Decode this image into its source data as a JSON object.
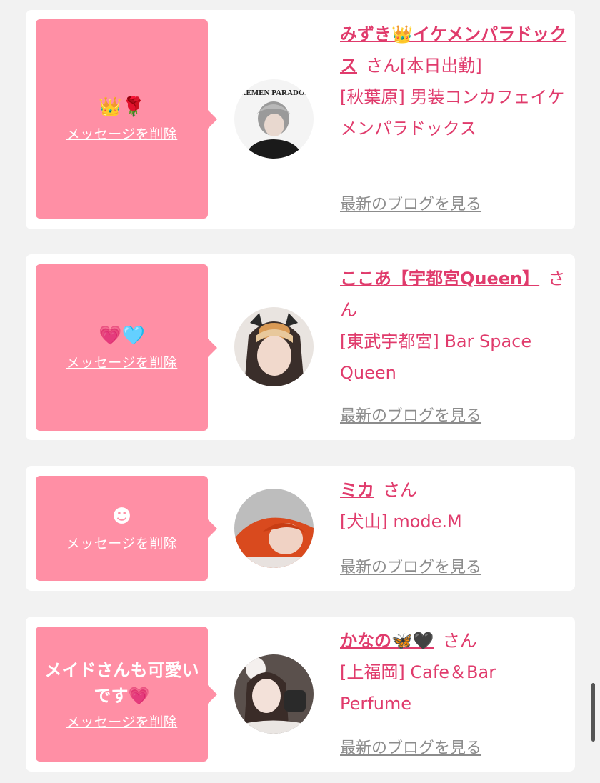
{
  "cards": [
    {
      "message": "👑🌹",
      "delete_label": "メッセージを削除",
      "name": "みずき👑イケメンパラドックス",
      "honorific": "さん[本日出勤]",
      "shop": "[秋葉原] 男装コンカフェイケメンパラドックス",
      "blog_label": "最新のブログを見る",
      "avatar_text": "IKEMEN PARADOX"
    },
    {
      "message": "💗🩵",
      "delete_label": "メッセージを削除",
      "name": "ここあ【宇都宮Queen】",
      "honorific": "さん",
      "shop": "[東武宇都宮] Bar Space Queen",
      "blog_label": "最新のブログを見る"
    },
    {
      "message": "☻",
      "delete_label": "メッセージを削除",
      "name": "ミカ",
      "honorific": "さん",
      "shop": "[犬山] mode.M",
      "blog_label": "最新のブログを見る"
    },
    {
      "message": "メイドさんも可愛いです💗",
      "delete_label": "メッセージを削除",
      "name": "かなの🦋🖤",
      "honorific": "さん",
      "shop": "[上福岡] Cafe＆Bar Perfume",
      "blog_label": "最新のブログを見る"
    }
  ],
  "colors": {
    "background": "#f2f2f2",
    "card": "#ffffff",
    "bubble": "#ff8fa5",
    "accent": "#e03b6c",
    "link_gray": "#8c8c8c"
  }
}
